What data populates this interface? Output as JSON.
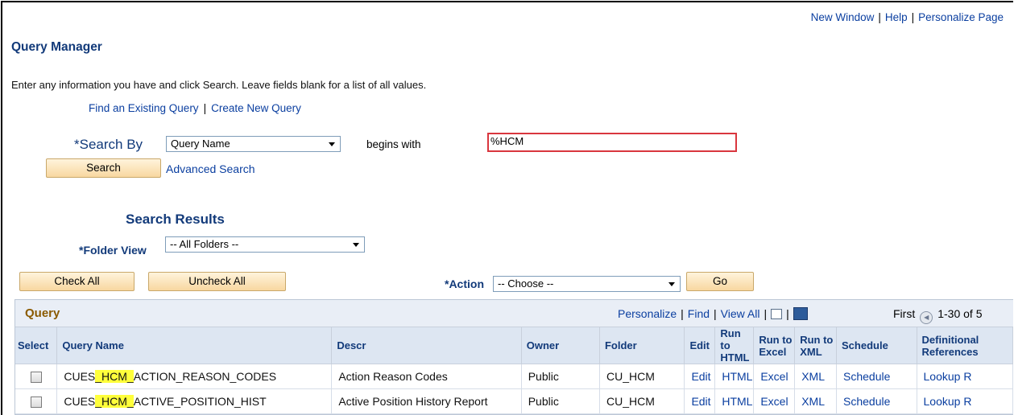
{
  "top_links": [
    "New Window",
    "Help",
    "Personalize Page"
  ],
  "page_title": "Query Manager",
  "instructions": "Enter any information you have and click Search. Leave fields blank for a list of all values.",
  "sub_links": {
    "find": "Find an Existing Query",
    "create": "Create New Query"
  },
  "search": {
    "label": "*Search By",
    "by_value": "Query Name",
    "operator": "begins with",
    "value": "%HCM",
    "search_button": "Search",
    "advanced_link": "Advanced Search"
  },
  "results": {
    "title": "Search Results",
    "folder_label": "*Folder View",
    "folder_value": "-- All Folders --",
    "check_all": "Check All",
    "uncheck_all": "Uncheck All",
    "action_label": "*Action",
    "action_value": "-- Choose --",
    "go": "Go"
  },
  "grid": {
    "title": "Query",
    "personalize": "Personalize",
    "find": "Find",
    "view_all": "View All",
    "first": "First",
    "range": "1-30 of 5",
    "columns": {
      "select": "Select",
      "name": "Query Name",
      "descr": "Descr",
      "owner": "Owner",
      "folder": "Folder",
      "edit": "Edit",
      "html": "Run to HTML",
      "excel": "Run to Excel",
      "xml": "Run to XML",
      "schedule": "Schedule",
      "def": "Definitional References"
    },
    "rows": [
      {
        "name_pre": "CUES",
        "name_hl": "_HCM_",
        "name_post": "ACTION_REASON_CODES",
        "descr": "Action Reason Codes",
        "owner": "Public",
        "folder": "CU_HCM",
        "edit": "Edit",
        "html": "HTML",
        "excel": "Excel",
        "xml": "XML",
        "schedule": "Schedule",
        "def": "Lookup R"
      },
      {
        "name_pre": "CUES",
        "name_hl": "_HCM_",
        "name_post": "ACTIVE_POSITION_HIST",
        "descr": "Active Position History Report",
        "owner": "Public",
        "folder": "CU_HCM",
        "edit": "Edit",
        "html": "HTML",
        "excel": "Excel",
        "xml": "XML",
        "schedule": "Schedule",
        "def": "Lookup R"
      }
    ]
  }
}
